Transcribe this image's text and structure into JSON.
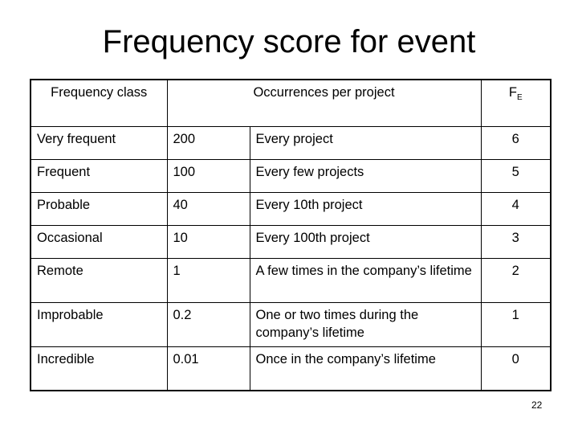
{
  "title": "Frequency score for event",
  "table": {
    "headers": {
      "frequency_class": "Frequency class",
      "occurrences": "Occurrences per project",
      "fe_main": "F",
      "fe_sub": "E"
    },
    "rows": [
      {
        "class": "Very frequent",
        "occurrences": "200",
        "description": "Every project",
        "fe": "6"
      },
      {
        "class": "Frequent",
        "occurrences": "100",
        "description": "Every few projects",
        "fe": "5"
      },
      {
        "class": "Probable",
        "occurrences": "40",
        "description": "Every 10th project",
        "fe": "4"
      },
      {
        "class": "Occasional",
        "occurrences": "10",
        "description": "Every 100th project",
        "fe": "3"
      },
      {
        "class": "Remote",
        "occurrences": "1",
        "description": "A few times in the company’s lifetime",
        "fe": "2"
      },
      {
        "class": "Improbable",
        "occurrences": "0.2",
        "description": "One or two times during the company’s lifetime",
        "fe": "1"
      },
      {
        "class": "Incredible",
        "occurrences": "0.01",
        "description": "Once in the company’s lifetime",
        "fe": "0"
      }
    ]
  },
  "page_number": "22"
}
